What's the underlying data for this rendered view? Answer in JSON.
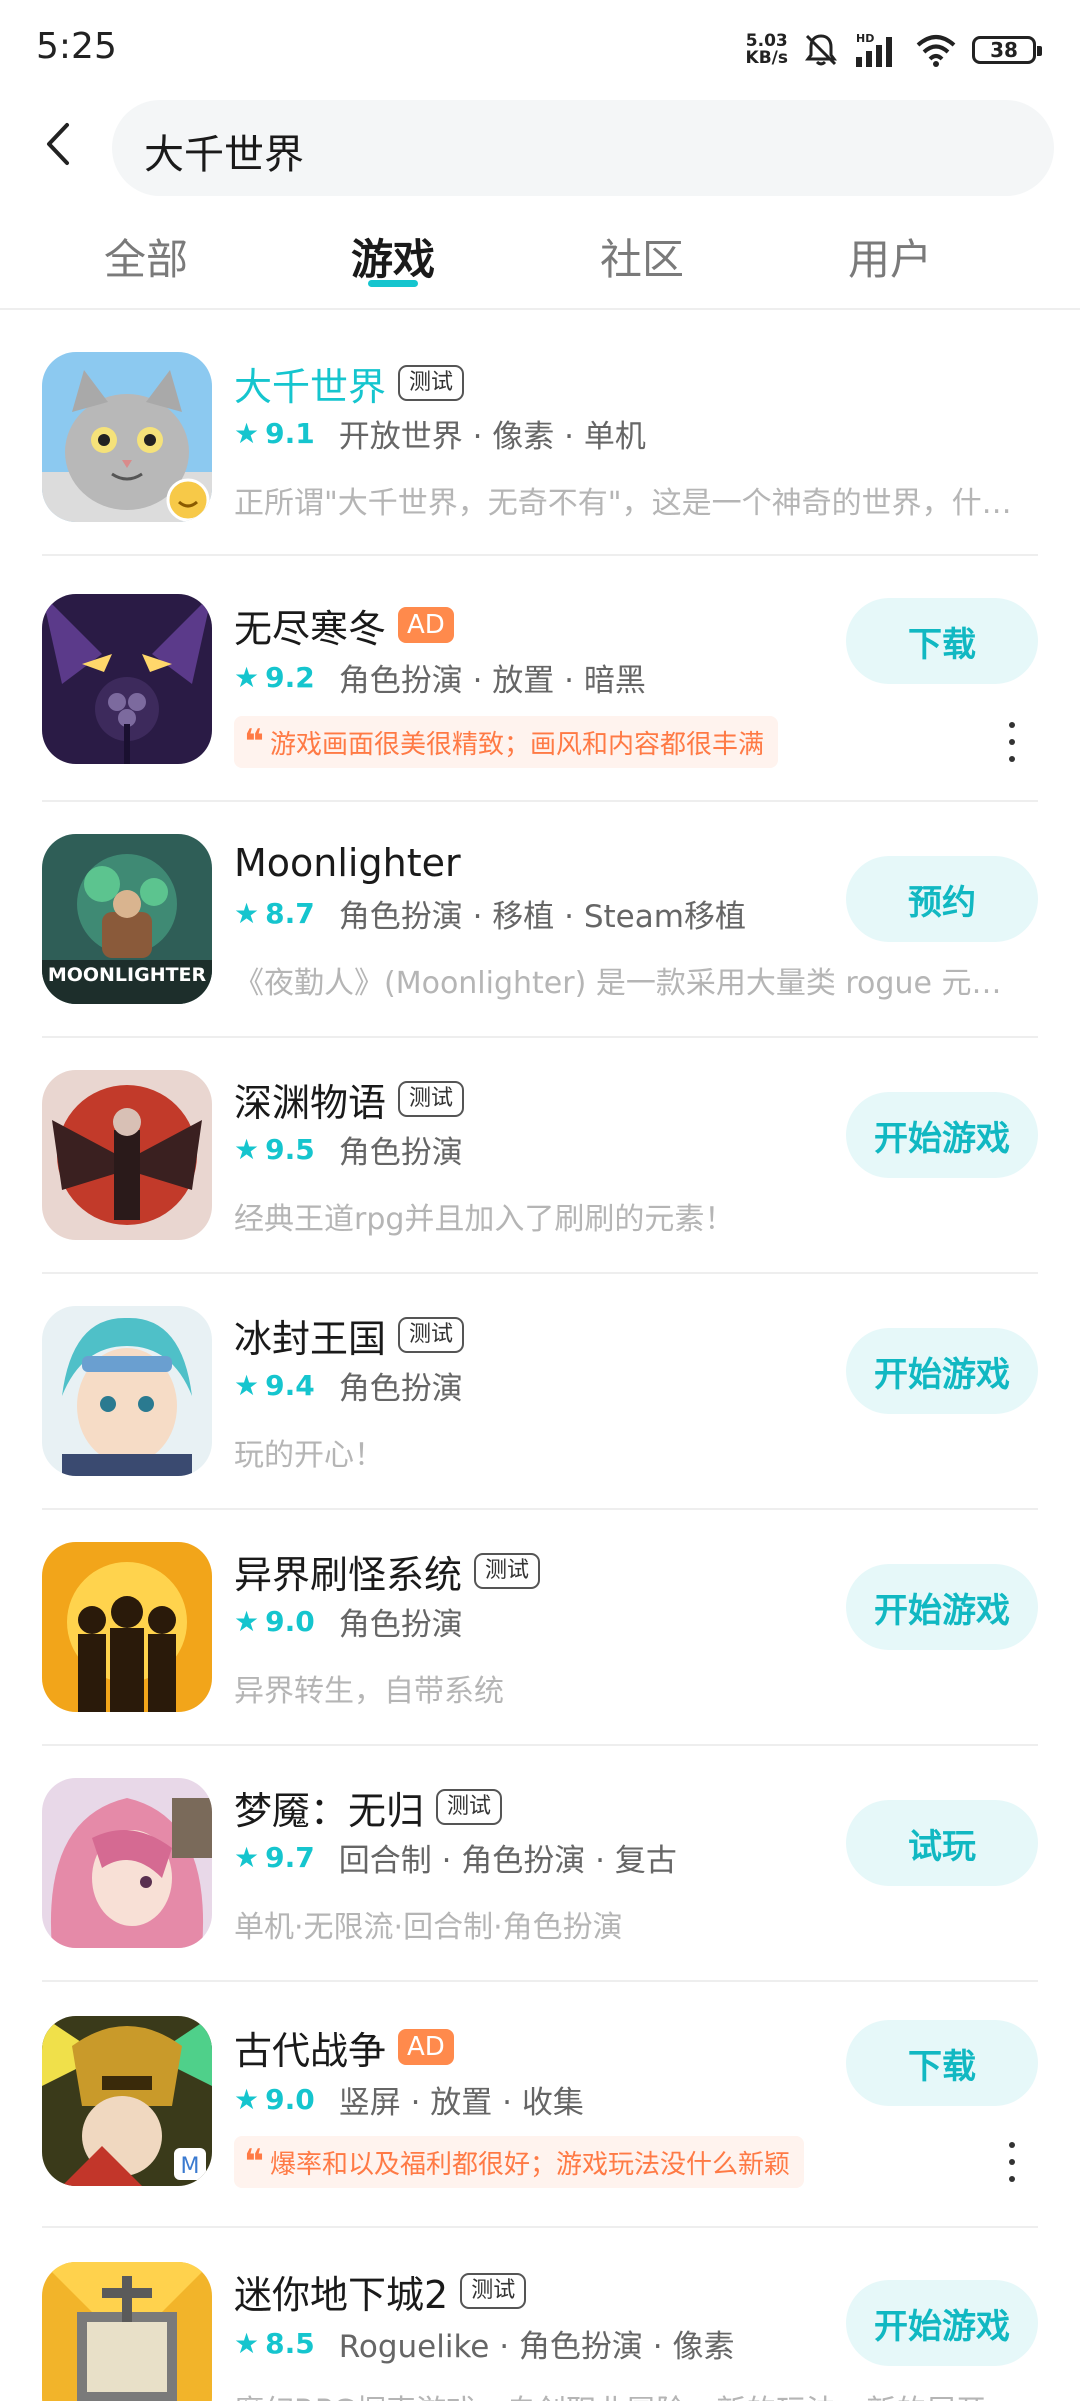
{
  "status_bar": {
    "time": "5:25",
    "net_speed_value": "5.03",
    "net_speed_unit": "KB/s",
    "battery": "38",
    "icons": [
      "mute-bell-icon",
      "hd-signal-icon",
      "wifi-icon"
    ]
  },
  "search": {
    "query": "大千世界"
  },
  "tabs": [
    {
      "label": "全部",
      "active": false
    },
    {
      "label": "游戏",
      "active": true
    },
    {
      "label": "社区",
      "active": false
    },
    {
      "label": "用户",
      "active": false
    }
  ],
  "colors": {
    "accent": "#15c5ce",
    "ad_tag": "#ff8a4c",
    "quote_text": "#ff7a45",
    "button_bg": "#e6f8f9"
  },
  "games": [
    {
      "name": "大千世界",
      "tag": "测试",
      "score": "9.1",
      "genres": "开放世界 · 像素 · 单机",
      "desc": "正所谓\"大千世界，无奇不有\"，这是一个神奇的世界，什么都有",
      "action": ""
    },
    {
      "name": "无尽寒冬",
      "tag": "AD",
      "score": "9.2",
      "genres": "角色扮演 · 放置 · 暗黑",
      "quote": "游戏画面很美很精致；画风和内容都很丰满",
      "action": "下载"
    },
    {
      "name": "Moonlighter",
      "tag": "",
      "icon_text": "MOONLIGHTER",
      "score": "8.7",
      "genres": "角色扮演 · 移植 · Steam移植",
      "desc": "《夜勤人》(Moonlighter) 是一款采用大量类 rogue 元素的动作角色扮演游戏",
      "action": "预约"
    },
    {
      "name": "深渊物语",
      "tag": "测试",
      "score": "9.5",
      "genres": "角色扮演",
      "desc": "经典王道rpg并且加入了刷刷的元素！",
      "action": "开始游戏"
    },
    {
      "name": "冰封王国",
      "tag": "测试",
      "score": "9.4",
      "genres": "角色扮演",
      "desc": "玩的开心！",
      "action": "开始游戏"
    },
    {
      "name": "异界刷怪系统",
      "tag": "测试",
      "score": "9.0",
      "genres": "角色扮演",
      "desc": "异界转生，自带系统",
      "action": "开始游戏"
    },
    {
      "name": "梦魇：无归",
      "tag": "测试",
      "score": "9.7",
      "genres": "回合制 · 角色扮演 · 复古",
      "desc": "单机·无限流·回合制·角色扮演",
      "action": "试玩"
    },
    {
      "name": "古代战争",
      "tag": "AD",
      "score": "9.0",
      "genres": "竖屏 · 放置 · 收集",
      "quote": "爆率和以及福利都很好；游戏玩法没什么新颖",
      "action": "下载"
    },
    {
      "name": "迷你地下城2",
      "tag": "测试",
      "score": "8.5",
      "genres": "Roguelike · 角色扮演 · 像素",
      "desc": "魔幻RPG探索游戏，自创职业冒险，新的玩法，新的展开",
      "action": "开始游戏"
    }
  ]
}
